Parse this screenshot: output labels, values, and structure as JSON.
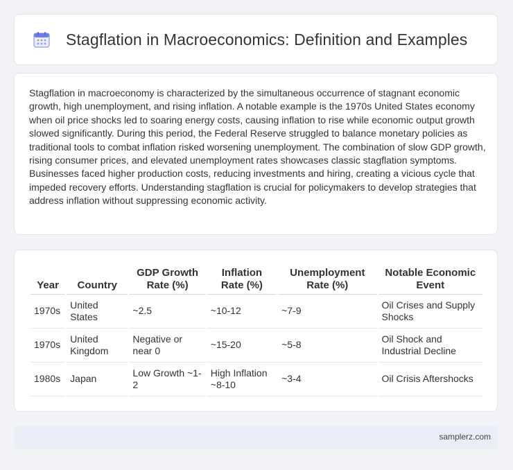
{
  "header": {
    "icon": "calendar-icon",
    "title": "Stagflation in Macroeconomics: Definition and Examples"
  },
  "intro": {
    "text": "Stagflation in macroeconomy is characterized by the simultaneous occurrence of stagnant economic growth, high unemployment, and rising inflation. A notable example is the 1970s United States economy when oil price shocks led to soaring energy costs, causing inflation to rise while economic output growth slowed significantly. During this period, the Federal Reserve struggled to balance monetary policies as traditional tools to combat inflation risked worsening unemployment. The combination of slow GDP growth, rising consumer prices, and elevated unemployment rates showcases classic stagflation symptoms. Businesses faced higher production costs, reducing investments and hiring, creating a vicious cycle that impeded recovery efforts. Understanding stagflation is crucial for policymakers to develop strategies that address inflation without suppressing economic activity."
  },
  "table": {
    "headers": [
      "Year",
      "Country",
      "GDP Growth Rate (%)",
      "Inflation Rate (%)",
      "Unemployment Rate (%)",
      "Notable Economic Event"
    ],
    "rows": [
      [
        "1970s",
        "United States",
        "~2.5",
        "~10-12",
        "~7-9",
        "Oil Crises and Supply Shocks"
      ],
      [
        "1970s",
        "United Kingdom",
        "Negative or near 0",
        "~15-20",
        "~5-8",
        "Oil Shock and Industrial Decline"
      ],
      [
        "1980s",
        "Japan",
        "Low Growth ~1-2",
        "High Inflation ~8-10",
        "~3-4",
        "Oil Crisis Aftershocks"
      ]
    ]
  },
  "footer": {
    "site": "samplerz.com"
  }
}
